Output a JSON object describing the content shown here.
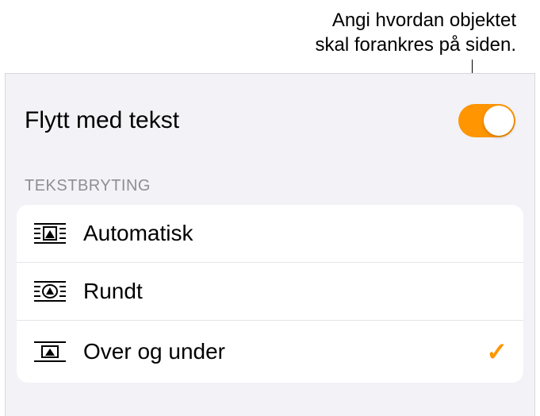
{
  "callout": {
    "line1": "Angi hvordan objektet",
    "line2": "skal forankres på siden."
  },
  "toggle": {
    "label": "Flytt med tekst",
    "enabled": true
  },
  "section": {
    "header": "TEKSTBRYTING",
    "items": [
      {
        "icon": "wrap-auto-icon",
        "label": "Automatisk",
        "selected": false
      },
      {
        "icon": "wrap-around-icon",
        "label": "Rundt",
        "selected": false
      },
      {
        "icon": "wrap-above-below-icon",
        "label": "Over og under",
        "selected": true
      }
    ]
  },
  "colors": {
    "accent": "#ff9500"
  }
}
